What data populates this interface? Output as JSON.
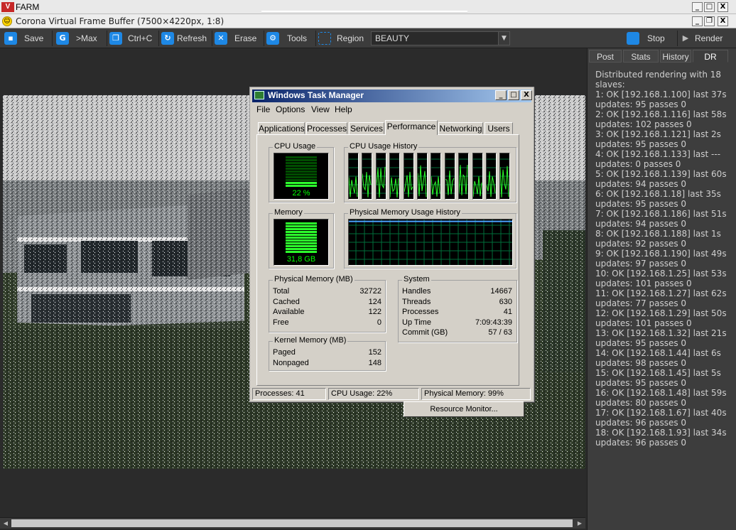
{
  "outer_window": {
    "logo": "V",
    "title": "FARM",
    "buttons": [
      "_",
      "□",
      "X"
    ]
  },
  "vfb_window": {
    "title": "Corona Virtual Frame Buffer (7500×4220px, 1:8)",
    "buttons": [
      "_",
      "❐",
      "X"
    ]
  },
  "toolbar": {
    "save": "Save",
    "max": ">Max",
    "copy": "Ctrl+C",
    "refresh": "Refresh",
    "erase": "Erase",
    "tools": "Tools",
    "region": "Region",
    "channel": "BEAUTY",
    "stop": "Stop",
    "render": "Render"
  },
  "right_panel": {
    "tabs": [
      "Post",
      "Stats",
      "History",
      "DR"
    ],
    "active_tab": "DR",
    "dr_lines": [
      "Distributed rendering with 18",
      "slaves:",
      "1: OK [192.168.1.100] last 37s",
      "updates: 95 passes 0",
      "2: OK [192.168.1.116] last 58s",
      "updates: 102 passes 0",
      "3: OK [192.168.1.121] last 2s",
      "updates: 95 passes 0",
      "4: OK [192.168.1.133] last ---",
      "updates: 0 passes 0",
      "5: OK [192.168.1.139] last 60s",
      "updates: 94 passes 0",
      "6: OK [192.168.1.18] last 35s",
      "updates: 95 passes 0",
      "7: OK [192.168.1.186] last 51s",
      "updates: 94 passes 0",
      "8: OK [192.168.1.188] last 1s",
      "updates: 92 passes 0",
      "9: OK [192.168.1.190] last 49s",
      "updates: 97 passes 0",
      "10: OK [192.168.1.25] last 53s",
      "updates: 101 passes 0",
      "11: OK [192.168.1.27] last 62s",
      "updates: 77 passes 0",
      "12: OK [192.168.1.29] last 50s",
      "updates: 101 passes 0",
      "13: OK [192.168.1.32] last 21s",
      "updates: 95 passes 0",
      "14: OK [192.168.1.44] last 6s",
      "updates: 98 passes 0",
      "15: OK [192.168.1.45] last 5s",
      "updates: 95 passes 0",
      "16: OK [192.168.1.48] last 59s",
      "updates: 80 passes 0",
      "17: OK [192.168.1.67] last 40s",
      "updates: 96 passes 0",
      "18: OK [192.168.1.93] last 34s",
      "updates: 96 passes 0"
    ]
  },
  "task_manager": {
    "title": "Windows Task Manager",
    "buttons": [
      "_",
      "□",
      "X"
    ],
    "menu": [
      "File",
      "Options",
      "View",
      "Help"
    ],
    "tabs": [
      "Applications",
      "Processes",
      "Services",
      "Performance",
      "Networking",
      "Users"
    ],
    "active_tab": "Performance",
    "cpu_usage": {
      "label": "CPU Usage",
      "value": "22 %",
      "fraction": 0.22
    },
    "cpu_history": {
      "label": "CPU Usage History",
      "cores": 12
    },
    "memory": {
      "label": "Memory",
      "value": "31,8 GB",
      "fraction": 0.99
    },
    "memory_history": {
      "label": "Physical Memory Usage History"
    },
    "physical_memory": {
      "label": "Physical Memory (MB)",
      "rows": [
        [
          "Total",
          "32722"
        ],
        [
          "Cached",
          "124"
        ],
        [
          "Available",
          "122"
        ],
        [
          "Free",
          "0"
        ]
      ]
    },
    "kernel_memory": {
      "label": "Kernel Memory (MB)",
      "rows": [
        [
          "Paged",
          "152"
        ],
        [
          "Nonpaged",
          "148"
        ]
      ]
    },
    "system": {
      "label": "System",
      "rows": [
        [
          "Handles",
          "14667"
        ],
        [
          "Threads",
          "630"
        ],
        [
          "Processes",
          "41"
        ],
        [
          "Up Time",
          "7:09:43:39"
        ],
        [
          "Commit (GB)",
          "57 / 63"
        ]
      ]
    },
    "resource_monitor": "Resource Monitor...",
    "status": {
      "processes": "Processes: 41",
      "cpu": "CPU Usage: 22%",
      "memory": "Physical Memory: 99%"
    }
  },
  "colors": {
    "accent": "#1e88e5",
    "meter_green": "#2cff2c",
    "title_blue": "#0a246a"
  }
}
